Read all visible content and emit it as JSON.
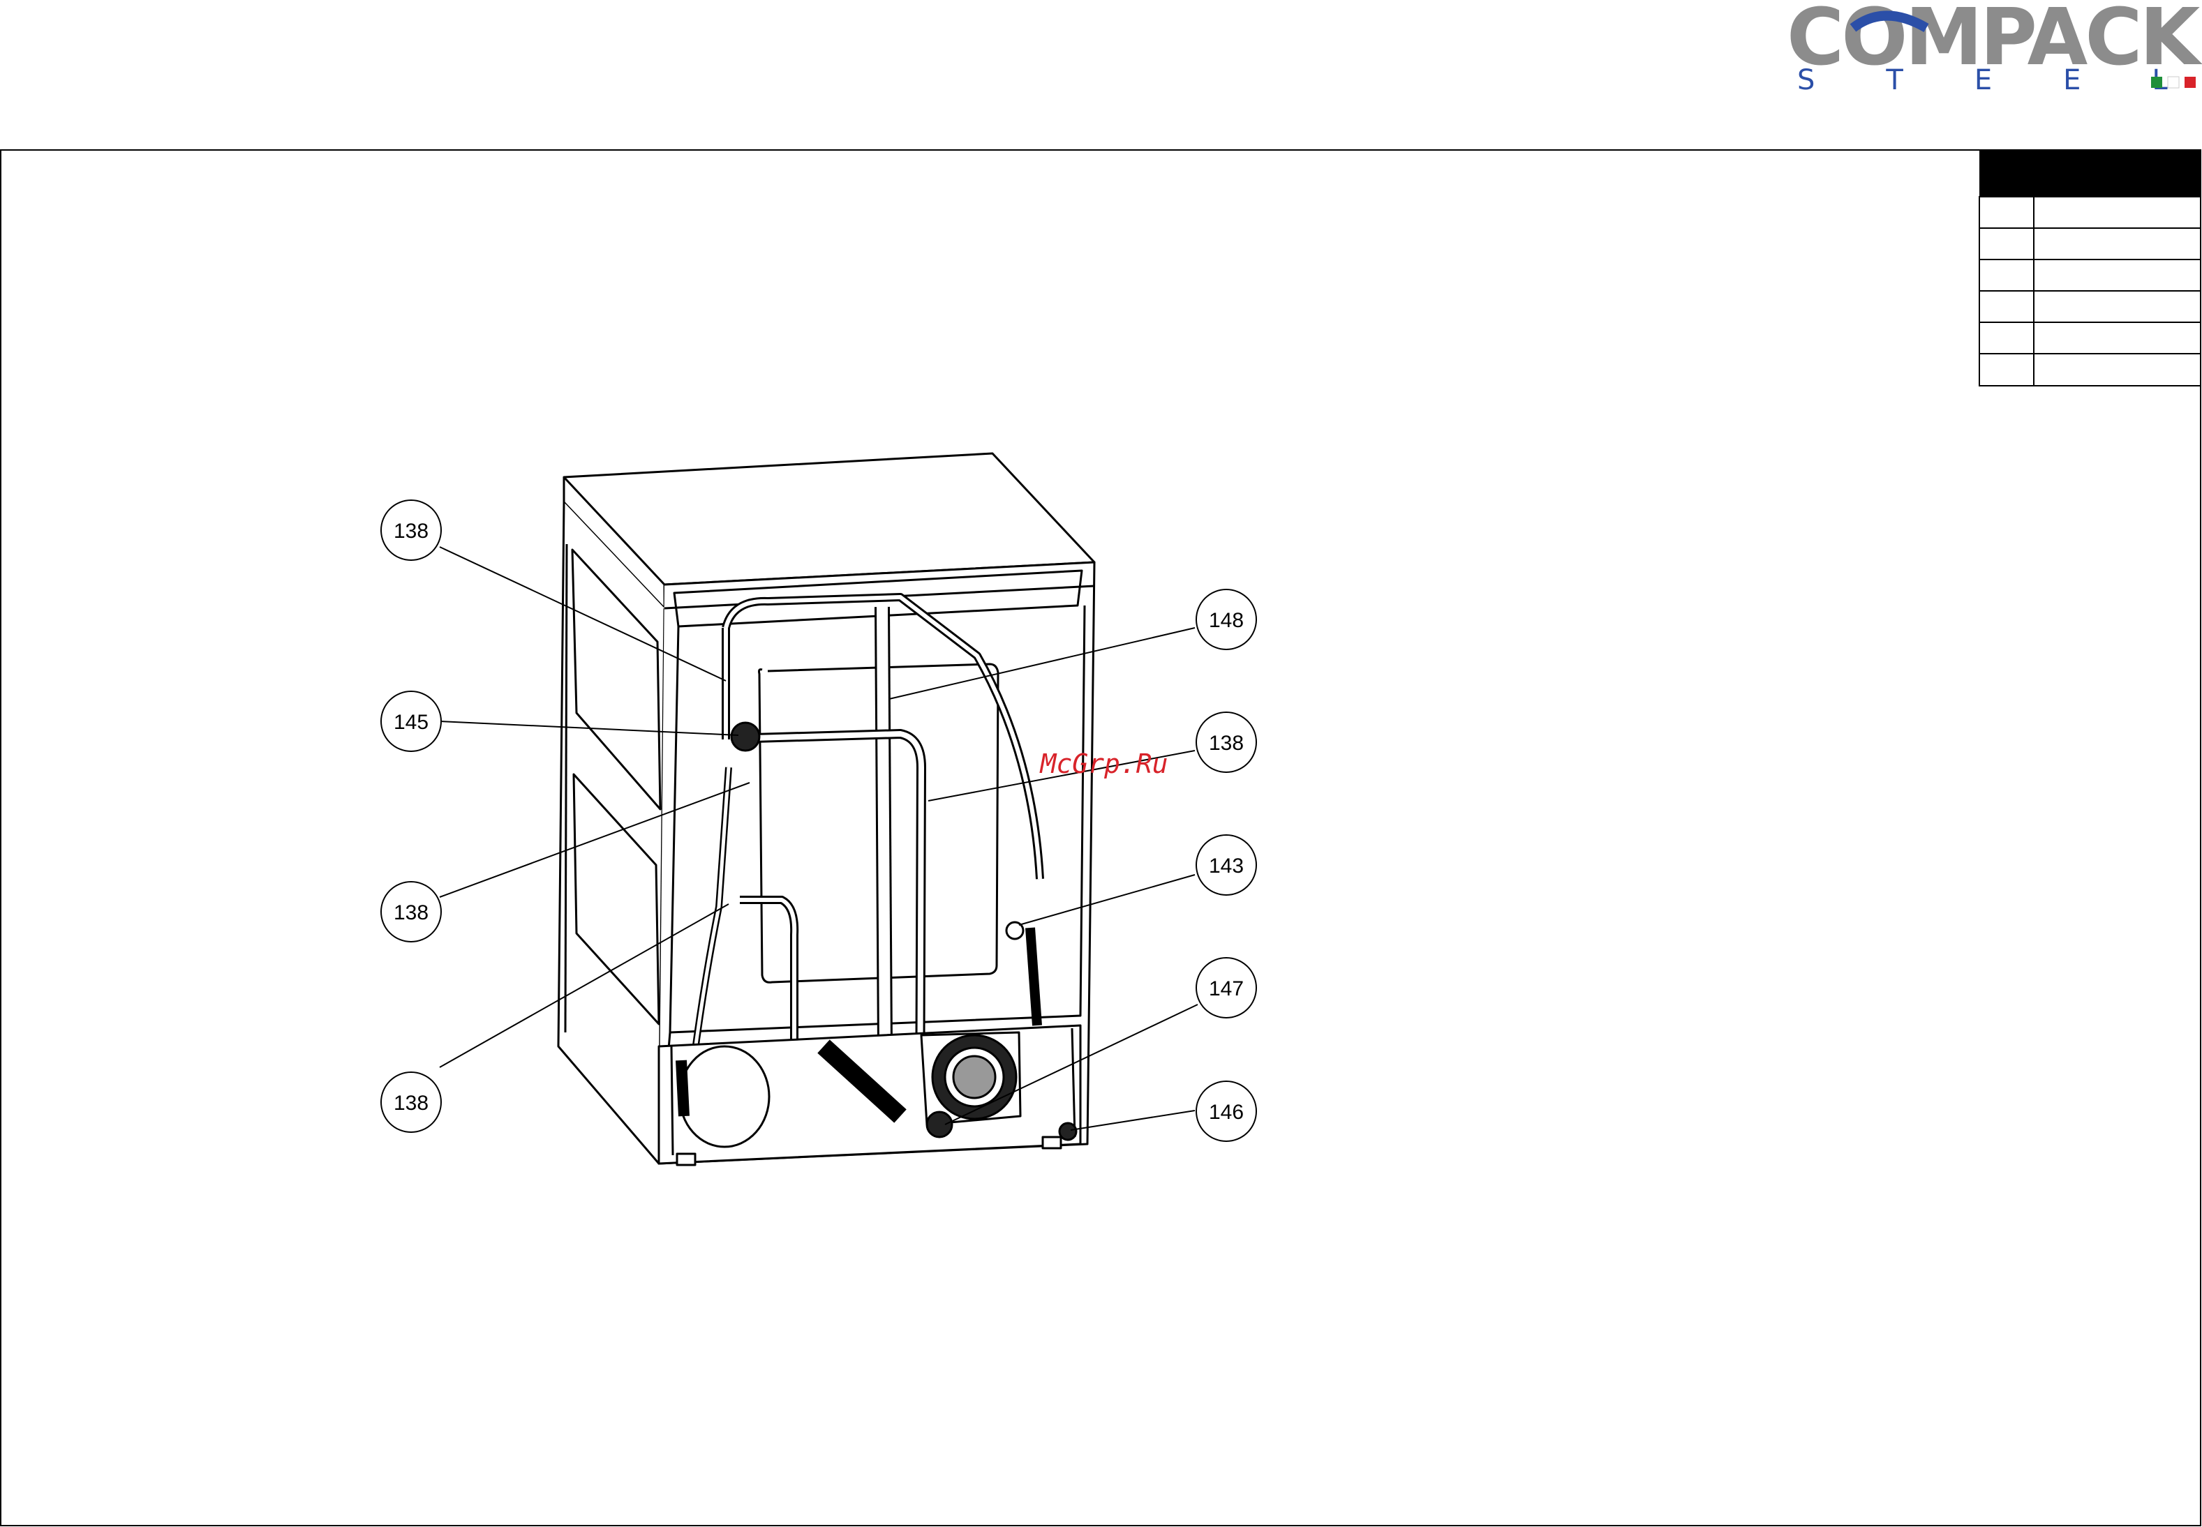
{
  "logo": {
    "brand": "COMPACK",
    "sub": "STEEL",
    "colors": {
      "main": "#8c8c8c",
      "accent": "#2b4fa8",
      "flag_green": "#1f8f3a",
      "flag_red": "#d8232a"
    }
  },
  "watermark": "McGrp.Ru",
  "callouts": [
    {
      "label": "138"
    },
    {
      "label": "145"
    },
    {
      "label": "138"
    },
    {
      "label": "138"
    },
    {
      "label": "148"
    },
    {
      "label": "138"
    },
    {
      "label": "143"
    },
    {
      "label": "147"
    },
    {
      "label": "146"
    }
  ],
  "parts_table": {
    "header": "",
    "rows": [
      {
        "pos": "",
        "desc": ""
      },
      {
        "pos": "",
        "desc": ""
      },
      {
        "pos": "",
        "desc": ""
      },
      {
        "pos": "",
        "desc": ""
      },
      {
        "pos": "",
        "desc": ""
      }
    ]
  }
}
